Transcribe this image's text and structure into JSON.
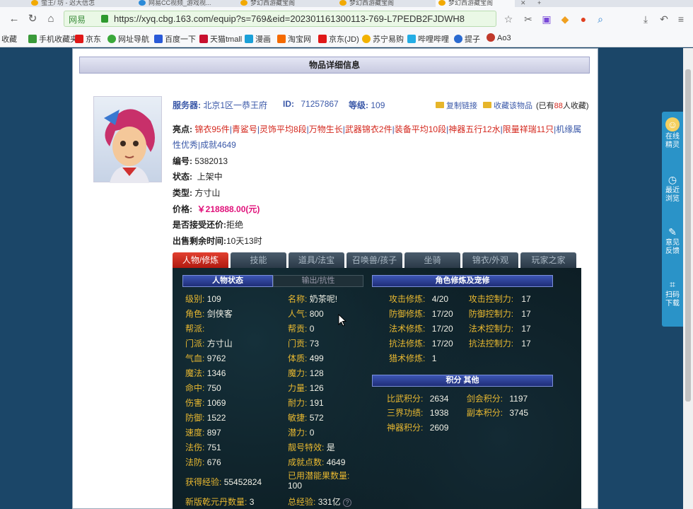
{
  "browser": {
    "tabs": [
      {
        "title": "萤王/ 坊 - 迟大信怎"
      },
      {
        "title": "网易CC视频_游戏视..."
      },
      {
        "title": "梦幻西游藏宝阁"
      },
      {
        "title": "梦幻西游藏宝阁"
      },
      {
        "title": "梦幻西游藏宝阁"
      }
    ],
    "site_label": "网易",
    "url": "https://xyq.cbg.163.com/equip?s=769&eid=202301161300113-769-L7PEDB2FJDWH8",
    "bookmarks": [
      "收藏",
      "手机收藏夹",
      "京东",
      "网址导航",
      "百度一下",
      "天猫tmall",
      "漫画",
      "淘宝网",
      "京东(JD)",
      "苏宁易购",
      "哔哩哔哩",
      "提子",
      "Ao3"
    ]
  },
  "page": {
    "title": "物品详细信息",
    "server_label": "服务器:",
    "server": "北京1区一恭王府",
    "id_label": "ID:",
    "id": "71257867",
    "level_label": "等级:",
    "level": "109",
    "copy_link": "复制链接",
    "fav": "收藏该物品",
    "fav_prefix": "(已有",
    "fav_count": "88",
    "fav_suffix": "人收藏)",
    "highlights_label": "亮点:",
    "highlights": [
      "锦衣95件",
      "青鲨号",
      "灵饰平均8段",
      "万物生长",
      "武器锦衣2件",
      "装备平均10段",
      "神器五行12水",
      "限量祥瑞11只",
      "机缘属性优秀",
      "成就4649"
    ],
    "serial_label": "编号:",
    "serial": "5382013",
    "status_label": "状态:",
    "status": "上架中",
    "type_label": "类型:",
    "type": "方寸山",
    "price_label": "价格:",
    "price": "￥218888.00(元)",
    "counter_label": "是否接受还价:",
    "counter": "拒绝",
    "remain_label": "出售剩余时间:",
    "remain": "10天13时"
  },
  "game_tabs": [
    "人物/修炼",
    "技能",
    "道具/法宝",
    "召唤兽/孩子",
    "坐骑",
    "锦衣/外观",
    "玩家之家"
  ],
  "panel": {
    "sec_status": "人物状态",
    "sec_output": "输出/抗性",
    "sec_train": "角色修炼及宠修",
    "sec_score": "积分 其他",
    "left": [
      {
        "k": "级别:",
        "v": "109"
      },
      {
        "k": "角色:",
        "v": "剑侠客"
      },
      {
        "k": "帮派:",
        "v": ""
      },
      {
        "k": "门派:",
        "v": "方寸山"
      },
      {
        "k": "气血:",
        "v": "9762"
      },
      {
        "k": "魔法:",
        "v": "1346"
      },
      {
        "k": "命中:",
        "v": "750"
      },
      {
        "k": "伤害:",
        "v": "1069"
      },
      {
        "k": "防御:",
        "v": "1522"
      },
      {
        "k": "速度:",
        "v": "897"
      },
      {
        "k": "法伤:",
        "v": "751"
      },
      {
        "k": "法防:",
        "v": "676"
      },
      {
        "k": "获得经验:",
        "v": "55452824"
      },
      {
        "k": "新版乾元丹数量:",
        "v": "3"
      }
    ],
    "mid": [
      {
        "k": "名称:",
        "v": "奶茶呢!"
      },
      {
        "k": "人气:",
        "v": "800"
      },
      {
        "k": "帮贡:",
        "v": "0"
      },
      {
        "k": "门贡:",
        "v": "73"
      },
      {
        "k": "体质:",
        "v": "499"
      },
      {
        "k": "魔力:",
        "v": "128"
      },
      {
        "k": "力量:",
        "v": "126"
      },
      {
        "k": "耐力:",
        "v": "191"
      },
      {
        "k": "敏捷:",
        "v": "572"
      },
      {
        "k": "潜力:",
        "v": "0"
      },
      {
        "k": "靓号特效:",
        "v": "是"
      },
      {
        "k": "成就点数:",
        "v": "4649"
      },
      {
        "k": "已用潜能果数量:",
        "v": "100"
      },
      {
        "k": "总经验:",
        "v": "331亿"
      }
    ],
    "train": [
      {
        "k": "攻击修炼:",
        "v": "4/20",
        "k2": "攻击控制力:",
        "v2": "17"
      },
      {
        "k": "防御修炼:",
        "v": "17/20",
        "k2": "防御控制力:",
        "v2": "17"
      },
      {
        "k": "法术修炼:",
        "v": "17/20",
        "k2": "法术控制力:",
        "v2": "17"
      },
      {
        "k": "抗法修炼:",
        "v": "17/20",
        "k2": "抗法控制力:",
        "v2": "17"
      },
      {
        "k": "猎术修炼:",
        "v": "1",
        "k2": "",
        "v2": ""
      }
    ],
    "score": [
      {
        "k": "比武积分:",
        "v": "2634",
        "k2": "剑会积分:",
        "v2": "1197"
      },
      {
        "k": "三界功绩:",
        "v": "1938",
        "k2": "副本积分:",
        "v2": "3745"
      },
      {
        "k": "神器积分:",
        "v": "2609",
        "k2": "",
        "v2": ""
      }
    ]
  },
  "side": [
    {
      "label": "在线精灵"
    },
    {
      "label": "最近浏览"
    },
    {
      "label": "意见反馈"
    },
    {
      "label": "扫码下载"
    }
  ]
}
